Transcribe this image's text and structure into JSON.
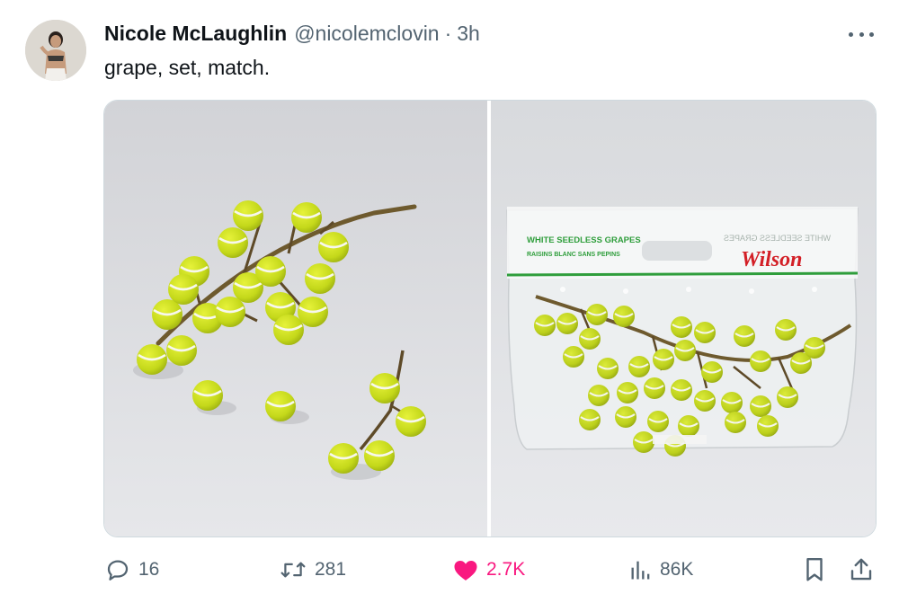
{
  "author": {
    "name": "Nicole McLaughlin",
    "handle": "@nicolemclovin",
    "separator": "·",
    "time": "3h"
  },
  "tweet_text": "grape, set, match.",
  "media": {
    "bag_top_label": "WHITE SEEDLESS GRAPES",
    "bag_sub_label": "RAISINS BLANC SANS PEPINS",
    "bag_mirror_label": "WHITE SEEDLESS GRAPES",
    "bag_brand": "Wilson"
  },
  "actions": {
    "replies": "16",
    "retweets": "281",
    "likes": "2.7K",
    "views": "86K"
  },
  "colors": {
    "like_pink": "#f91880",
    "muted": "#536471",
    "tennis_ball": "#c8e01c",
    "brand_red": "#d31f26",
    "bag_green": "#2f9e3c"
  },
  "icons": [
    "more-icon",
    "reply-icon",
    "retweet-icon",
    "like-icon",
    "views-icon",
    "bookmark-icon",
    "share-icon"
  ]
}
